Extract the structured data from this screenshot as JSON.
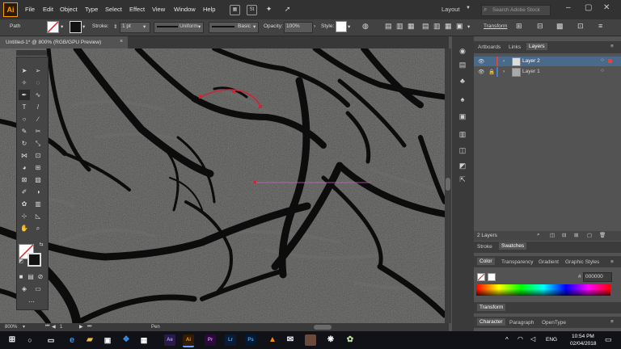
{
  "app": {
    "logo": "Ai"
  },
  "menu": [
    "File",
    "Edit",
    "Object",
    "Type",
    "Select",
    "Effect",
    "View",
    "Window",
    "Help"
  ],
  "menubar_icons": {
    "st": "St"
  },
  "workspace": {
    "label": "Layout",
    "search_placeholder": "Search Adobe Stock"
  },
  "control": {
    "selection_type": "Path",
    "stroke_label": "Stroke:",
    "stroke_weight": "1 pt",
    "profile": "Uniform",
    "brush": "Basic",
    "opacity_label": "Opacity:",
    "opacity": "100%",
    "style_label": "Style:",
    "transform": "Transform"
  },
  "document": {
    "tab_title": "Untitled-1* @ 800% (RGB/GPU Preview)",
    "close": "×"
  },
  "status": {
    "zoom": "800%",
    "artboard": "1",
    "tool": "Pen"
  },
  "panels": {
    "tabs": [
      "Artboards",
      "Links",
      "Layers"
    ],
    "active_tab": "Layers",
    "layers": [
      {
        "name": "Layer 2",
        "color": "#e0453a",
        "selected": true
      },
      {
        "name": "Layer 1",
        "color": "#4a7bd0",
        "selected": false
      }
    ],
    "layer_count": "2 Layers",
    "stroke_tabs": [
      "Stroke",
      "Swatches"
    ],
    "color_tabs": [
      "Color",
      "Transparency",
      "Gradient",
      "Graphic Styles"
    ],
    "hex_label": "#",
    "hex": "000000",
    "transform_title": "Transform",
    "char_tabs": [
      "Character",
      "Paragraph",
      "OpenType"
    ]
  },
  "taskbar": {
    "apps": [
      {
        "name": "Ae",
        "color": "#2a1a4a",
        "fg": "#9999ff"
      },
      {
        "name": "Ai",
        "color": "#331c00",
        "fg": "#ff9a00"
      },
      {
        "name": "Pr",
        "color": "#2a0a3a",
        "fg": "#e27cff"
      },
      {
        "name": "Lr",
        "color": "#0a1c33",
        "fg": "#3fa1ff"
      },
      {
        "name": "Ps",
        "color": "#001a33",
        "fg": "#31a8ff"
      }
    ],
    "lang": "ENG",
    "time": "10:54 PM",
    "date": "02/04/2018"
  }
}
